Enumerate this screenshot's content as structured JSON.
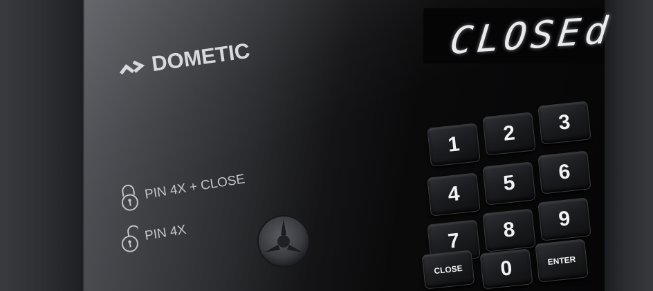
{
  "display": {
    "text": "CLOSEd"
  },
  "logo": {
    "text": "DOMETIC",
    "mark_icon": "chevron-logo-icon"
  },
  "instructions": [
    {
      "text": "PIN 4X + CLOSE",
      "icon": "lock-closed-icon"
    },
    {
      "text": "PIN 4X",
      "icon": "lock-open-icon"
    }
  ],
  "keypad": {
    "keys": [
      {
        "label": "1"
      },
      {
        "label": "2"
      },
      {
        "label": "3"
      },
      {
        "label": "4"
      },
      {
        "label": "5"
      },
      {
        "label": "6"
      },
      {
        "label": "7"
      },
      {
        "label": "8"
      },
      {
        "label": "9"
      },
      {
        "label": "CLOSE"
      },
      {
        "label": "0"
      },
      {
        "label": "ENTER"
      }
    ]
  },
  "colors": {
    "panel": "#0a0a0b",
    "display_glow": "#e9eaec",
    "print": "#c4c5c8"
  }
}
